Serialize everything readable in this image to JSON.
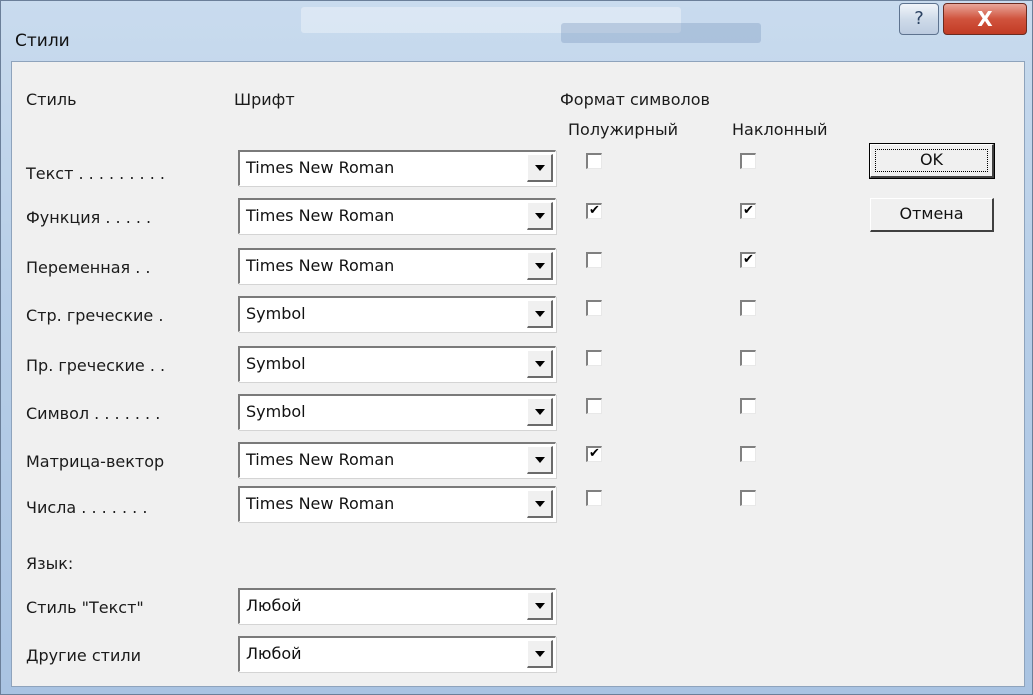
{
  "window": {
    "title": "Стили",
    "help_glyph": "?",
    "close_glyph": "X"
  },
  "headers": {
    "style": "Стиль",
    "font": "Шрифт",
    "char_format": "Формат символов",
    "bold": "Полужирный",
    "italic": "Наклонный"
  },
  "rows": [
    {
      "label": "Текст . . . . . . . . .",
      "font": "Times New Roman",
      "bold": false,
      "italic": false
    },
    {
      "label": "Функция . . . . .",
      "font": "Times New Roman",
      "bold": true,
      "italic": true
    },
    {
      "label": "Переменная . .",
      "font": "Times New Roman",
      "bold": false,
      "italic": true
    },
    {
      "label": "Стр. греческие .",
      "font": "Symbol",
      "bold": false,
      "italic": false
    },
    {
      "label": "Пр. греческие . .",
      "font": "Symbol",
      "bold": false,
      "italic": false
    },
    {
      "label": "Символ . . . . . . .",
      "font": "Symbol",
      "bold": false,
      "italic": false
    },
    {
      "label": "Матрица-вектор",
      "font": "Times New Roman",
      "bold": true,
      "italic": false
    },
    {
      "label": "Числа . . . . . . .",
      "font": "Times New Roman",
      "bold": false,
      "italic": false
    }
  ],
  "language": {
    "heading": "Язык:",
    "text_style_label": "Стиль \"Текст\"",
    "text_style_value": "Любой",
    "other_styles_label": "Другие стили",
    "other_styles_value": "Любой"
  },
  "buttons": {
    "ok": "OK",
    "cancel": "Отмена"
  },
  "colors": {
    "title_bar": "#b8cfe8",
    "dialog_face": "#f0f0f0",
    "close_button": "#c94a33"
  }
}
